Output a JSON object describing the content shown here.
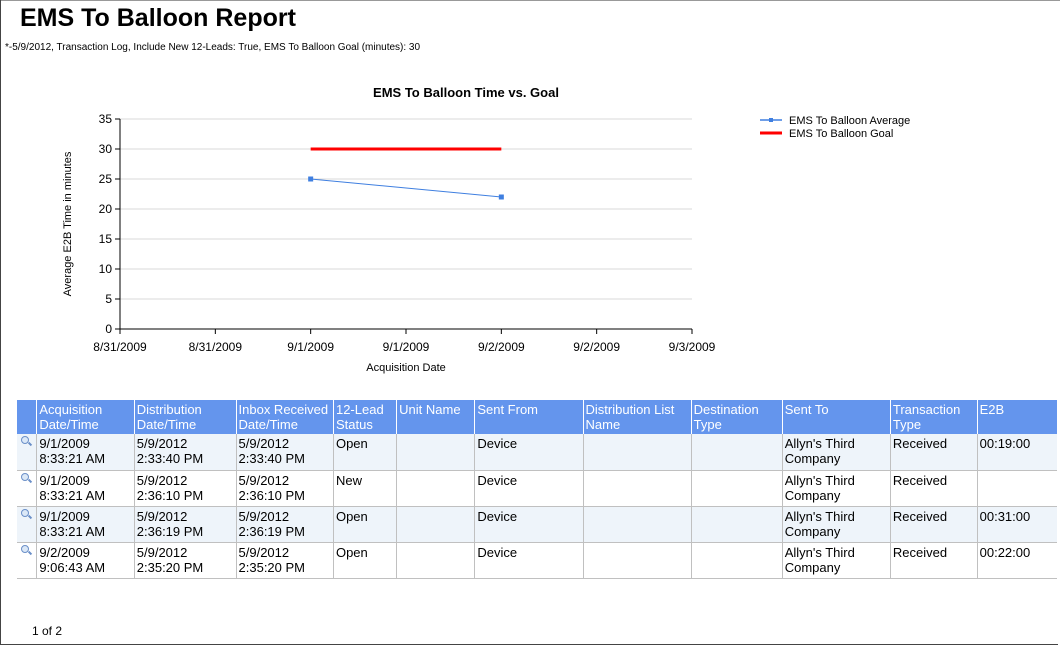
{
  "report": {
    "title": "EMS To Balloon Report",
    "subtitle": "*-5/9/2012, Transaction Log, Include New 12-Leads: True, EMS To Balloon Goal (minutes): 30"
  },
  "chart_data": {
    "type": "line",
    "title": "EMS To Balloon Time vs. Goal",
    "xlabel": "Acquisition Date",
    "ylabel": "Average E2B Time in minutes",
    "ylim": [
      0,
      35
    ],
    "yticks": [
      0,
      5,
      10,
      15,
      20,
      25,
      30,
      35
    ],
    "x_tick_labels": [
      "8/31/2009",
      "8/31/2009",
      "9/1/2009",
      "9/1/2009",
      "9/2/2009",
      "9/2/2009",
      "9/3/2009"
    ],
    "legend_position": "top-right",
    "grid": true,
    "series": [
      {
        "name": "EMS To Balloon Average",
        "color": "#3f7fe0",
        "x": [
          "9/1/2009",
          "9/2/2009"
        ],
        "y": [
          25,
          22
        ]
      },
      {
        "name": "EMS To Balloon Goal",
        "color": "#ff0000",
        "x": [
          "9/1/2009",
          "9/2/2009"
        ],
        "y": [
          30,
          30
        ]
      }
    ]
  },
  "table": {
    "header_color": "#6495ed",
    "columns": [
      "Acquisition Date/Time",
      "Distribution Date/Time",
      "Inbox Received Date/Time",
      "12-Lead Status",
      "Unit Name",
      "Sent From",
      "Distribution List Name",
      "Destination Type",
      "Sent To",
      "Transaction Type",
      "E2B"
    ],
    "rows": [
      [
        "9/1/2009 8:33:21 AM",
        "5/9/2012 2:33:40 PM",
        "5/9/2012 2:33:40 PM",
        "Open",
        "",
        "Device",
        "",
        "",
        "Allyn's Third Company",
        "Received",
        "00:19:00"
      ],
      [
        "9/1/2009 8:33:21 AM",
        "5/9/2012 2:36:10 PM",
        "5/9/2012 2:36:10 PM",
        "New",
        "",
        "Device",
        "",
        "",
        "Allyn's Third Company",
        "Received",
        ""
      ],
      [
        "9/1/2009 8:33:21 AM",
        "5/9/2012 2:36:19 PM",
        "5/9/2012 2:36:19 PM",
        "Open",
        "",
        "Device",
        "",
        "",
        "Allyn's Third Company",
        "Received",
        "00:31:00"
      ],
      [
        "9/2/2009 9:06:43 AM",
        "5/9/2012 2:35:20 PM",
        "5/9/2012 2:35:20 PM",
        "Open",
        "",
        "Device",
        "",
        "",
        "Allyn's Third Company",
        "Received",
        "00:22:00"
      ]
    ]
  },
  "pager": {
    "text": "1 of 2"
  }
}
